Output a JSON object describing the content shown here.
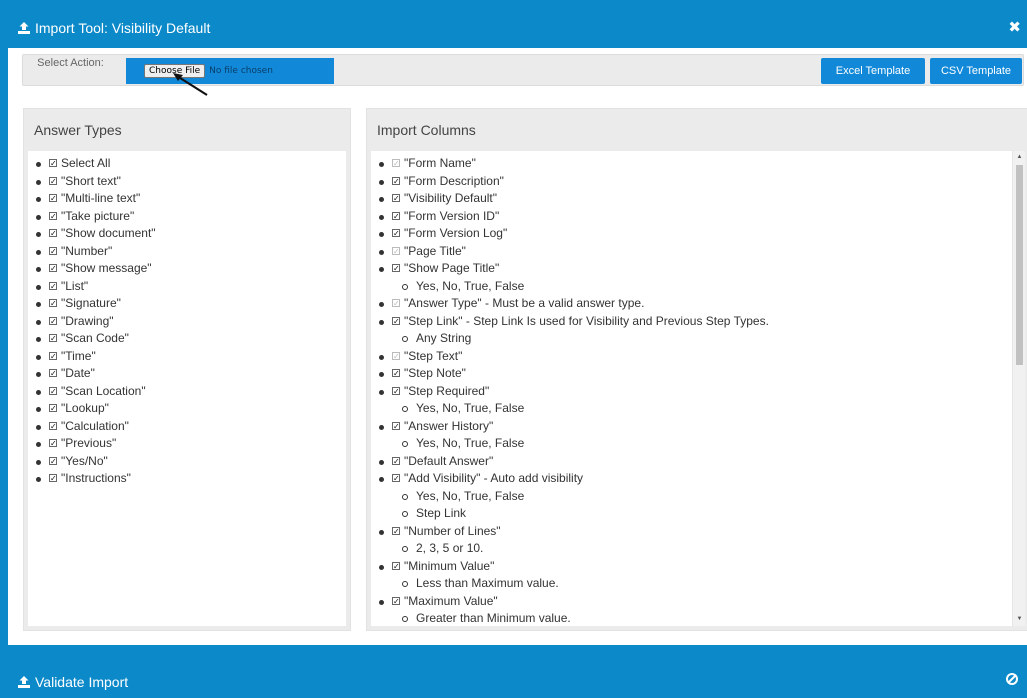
{
  "window": {
    "title": "Import Tool: Visibility Default"
  },
  "action": {
    "label": "Select Action:",
    "choose_file": "Choose File",
    "no_file": "No file chosen",
    "excel_template": "Excel Template",
    "csv_template": "CSV Template"
  },
  "answer_types": {
    "heading": "Answer Types",
    "items": [
      "Select All",
      "\"Short text\"",
      "\"Multi-line text\"",
      "\"Take picture\"",
      "\"Show document\"",
      "\"Number\"",
      "\"Show message\"",
      "\"List\"",
      "\"Signature\"",
      "\"Drawing\"",
      "\"Scan Code\"",
      "\"Time\"",
      "\"Date\"",
      "\"Scan Location\"",
      "\"Lookup\"",
      "\"Calculation\"",
      "\"Previous\"",
      "\"Yes/No\"",
      "\"Instructions\""
    ]
  },
  "import_columns": {
    "heading": "Import Columns",
    "items": [
      {
        "label": "\"Form Name\"",
        "disabled": true
      },
      {
        "label": "\"Form Description\""
      },
      {
        "label": "\"Visibility Default\""
      },
      {
        "label": "\"Form Version ID\""
      },
      {
        "label": "\"Form Version Log\""
      },
      {
        "label": "\"Page Title\"",
        "disabled": true
      },
      {
        "label": "\"Show Page Title\"",
        "sub": [
          "Yes, No, True, False"
        ]
      },
      {
        "label": "\"Answer Type\" - Must be a valid answer type.",
        "disabled": true
      },
      {
        "label": "\"Step Link\" - Step Link Is used for Visibility and Previous Step Types.",
        "sub": [
          "Any String"
        ]
      },
      {
        "label": "\"Step Text\"",
        "disabled": true
      },
      {
        "label": "\"Step Note\""
      },
      {
        "label": "\"Step Required\"",
        "sub": [
          "Yes, No, True, False"
        ]
      },
      {
        "label": "\"Answer History\"",
        "sub": [
          "Yes, No, True, False"
        ]
      },
      {
        "label": "\"Default Answer\""
      },
      {
        "label": "\"Add Visibility\" - Auto add visibility",
        "sub": [
          "Yes, No, True, False",
          "Step Link"
        ]
      },
      {
        "label": "\"Number of Lines\"",
        "sub": [
          "2, 3, 5 or 10."
        ]
      },
      {
        "label": "\"Minimum Value\"",
        "sub": [
          "Less than Maximum value."
        ]
      },
      {
        "label": "\"Maximum Value\"",
        "sub": [
          "Greater than Minimum value."
        ]
      }
    ]
  },
  "footer": {
    "validate": "Validate Import"
  },
  "colors": {
    "brand": "#0c89c9",
    "button": "#1188d8"
  },
  "icons": {
    "title": "upload-icon",
    "close": "close-icon",
    "footer": "ban-icon"
  }
}
